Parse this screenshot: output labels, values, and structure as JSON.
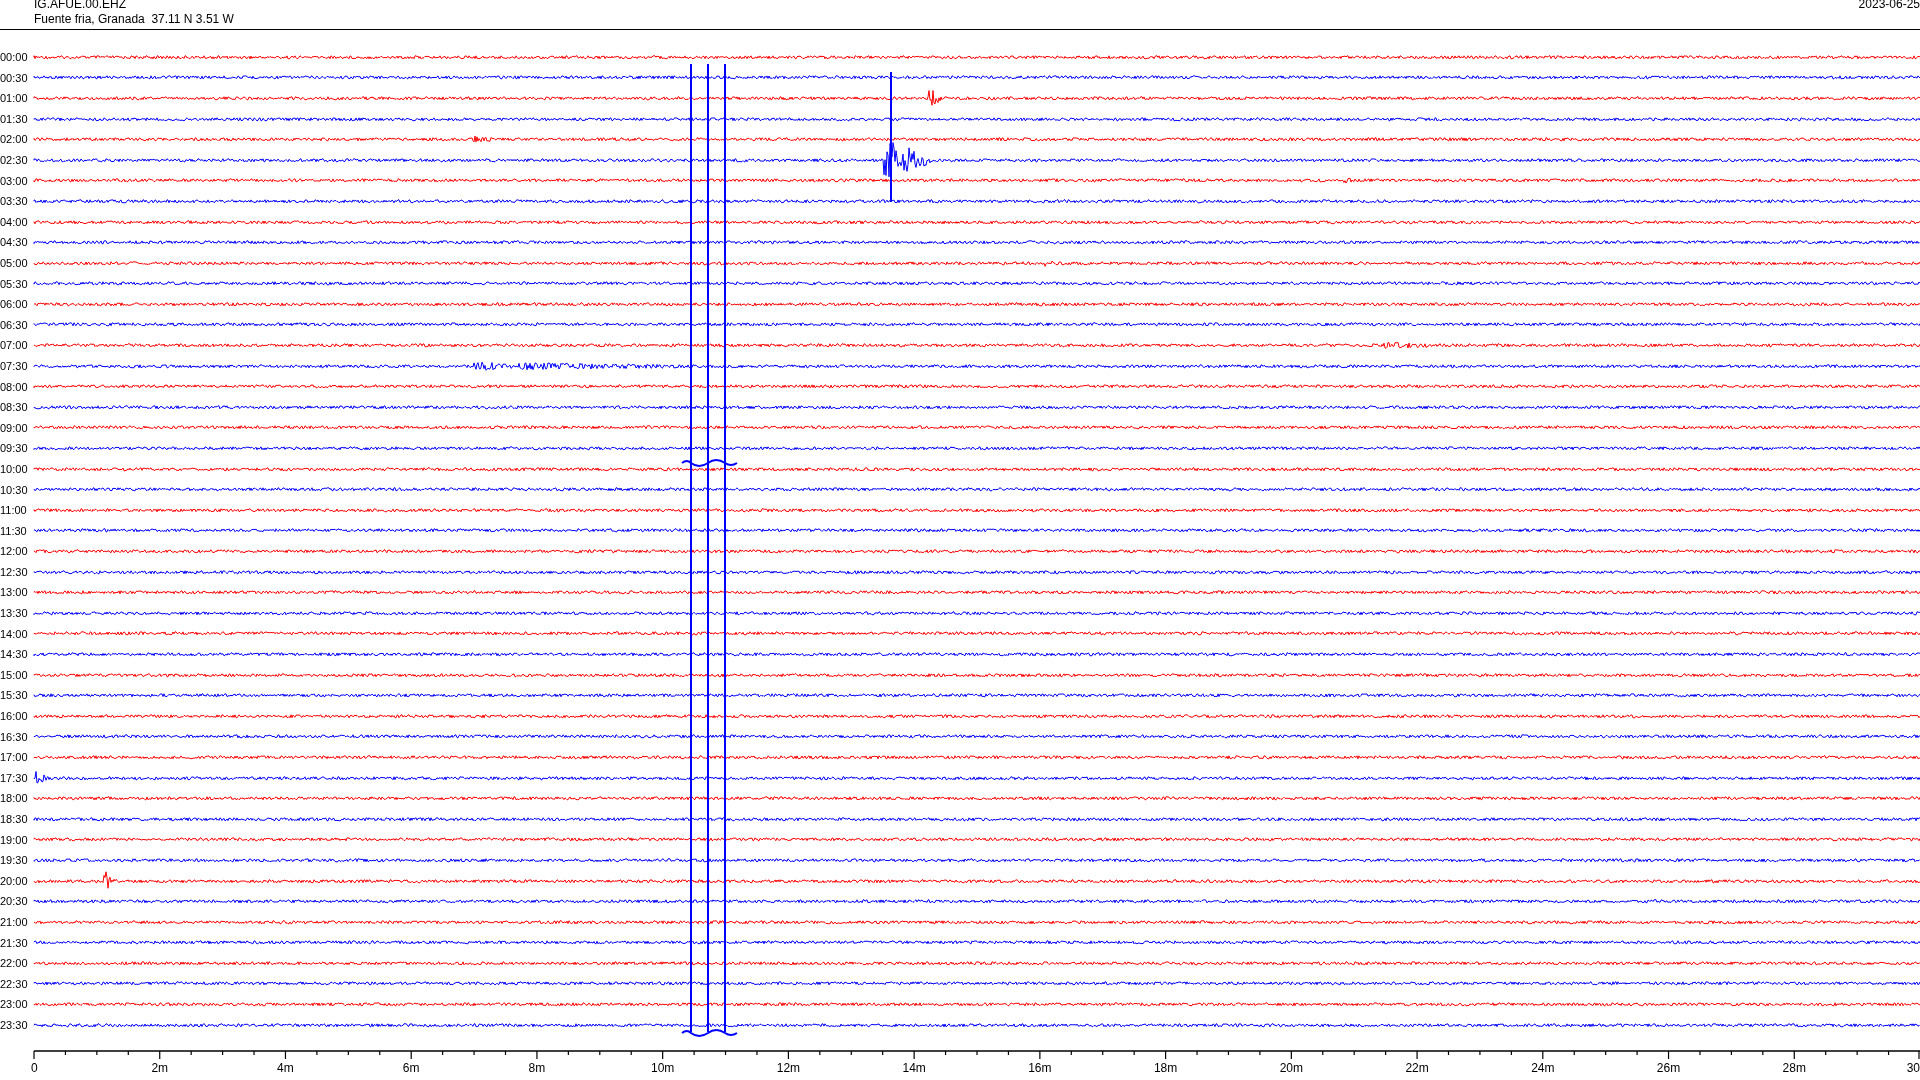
{
  "header": {
    "station": "IG.AFUE.00.EHZ",
    "location": "Fuente fria, Granada  37.11 N 3.51 W",
    "date": "2023-06-25"
  },
  "rows": [
    {
      "label": "00:00",
      "color": "#ff0000"
    },
    {
      "label": "00:30",
      "color": "#0000ff"
    },
    {
      "label": "01:00",
      "color": "#ff0000"
    },
    {
      "label": "01:30",
      "color": "#0000ff"
    },
    {
      "label": "02:00",
      "color": "#ff0000"
    },
    {
      "label": "02:30",
      "color": "#0000ff"
    },
    {
      "label": "03:00",
      "color": "#ff0000"
    },
    {
      "label": "03:30",
      "color": "#0000ff"
    },
    {
      "label": "04:00",
      "color": "#ff0000"
    },
    {
      "label": "04:30",
      "color": "#0000ff"
    },
    {
      "label": "05:00",
      "color": "#ff0000"
    },
    {
      "label": "05:30",
      "color": "#0000ff"
    },
    {
      "label": "06:00",
      "color": "#ff0000"
    },
    {
      "label": "06:30",
      "color": "#0000ff"
    },
    {
      "label": "07:00",
      "color": "#ff0000"
    },
    {
      "label": "07:30",
      "color": "#0000ff"
    },
    {
      "label": "08:00",
      "color": "#ff0000"
    },
    {
      "label": "08:30",
      "color": "#0000ff"
    },
    {
      "label": "09:00",
      "color": "#ff0000"
    },
    {
      "label": "09:30",
      "color": "#0000ff"
    },
    {
      "label": "10:00",
      "color": "#ff0000"
    },
    {
      "label": "10:30",
      "color": "#0000ff"
    },
    {
      "label": "11:00",
      "color": "#ff0000"
    },
    {
      "label": "11:30",
      "color": "#0000ff"
    },
    {
      "label": "12:00",
      "color": "#ff0000"
    },
    {
      "label": "12:30",
      "color": "#0000ff"
    },
    {
      "label": "13:00",
      "color": "#ff0000"
    },
    {
      "label": "13:30",
      "color": "#0000ff"
    },
    {
      "label": "14:00",
      "color": "#ff0000"
    },
    {
      "label": "14:30",
      "color": "#0000ff"
    },
    {
      "label": "15:00",
      "color": "#ff0000"
    },
    {
      "label": "15:30",
      "color": "#0000ff"
    },
    {
      "label": "16:00",
      "color": "#ff0000"
    },
    {
      "label": "16:30",
      "color": "#0000ff"
    },
    {
      "label": "17:00",
      "color": "#ff0000"
    },
    {
      "label": "17:30",
      "color": "#0000ff"
    },
    {
      "label": "18:00",
      "color": "#ff0000"
    },
    {
      "label": "18:30",
      "color": "#0000ff"
    },
    {
      "label": "19:00",
      "color": "#ff0000"
    },
    {
      "label": "19:30",
      "color": "#0000ff"
    },
    {
      "label": "20:00",
      "color": "#ff0000"
    },
    {
      "label": "20:30",
      "color": "#0000ff"
    },
    {
      "label": "21:00",
      "color": "#ff0000"
    },
    {
      "label": "21:30",
      "color": "#0000ff"
    },
    {
      "label": "22:00",
      "color": "#ff0000"
    },
    {
      "label": "22:30",
      "color": "#0000ff"
    },
    {
      "label": "23:00",
      "color": "#ff0000"
    },
    {
      "label": "23:30",
      "color": "#0000ff"
    }
  ],
  "x_axis": {
    "ticks": [
      "0",
      "2m",
      "4m",
      "6m",
      "8m",
      "10m",
      "12m",
      "14m",
      "16m",
      "18m",
      "20m",
      "22m",
      "24m",
      "26m",
      "28m",
      "30"
    ]
  }
}
